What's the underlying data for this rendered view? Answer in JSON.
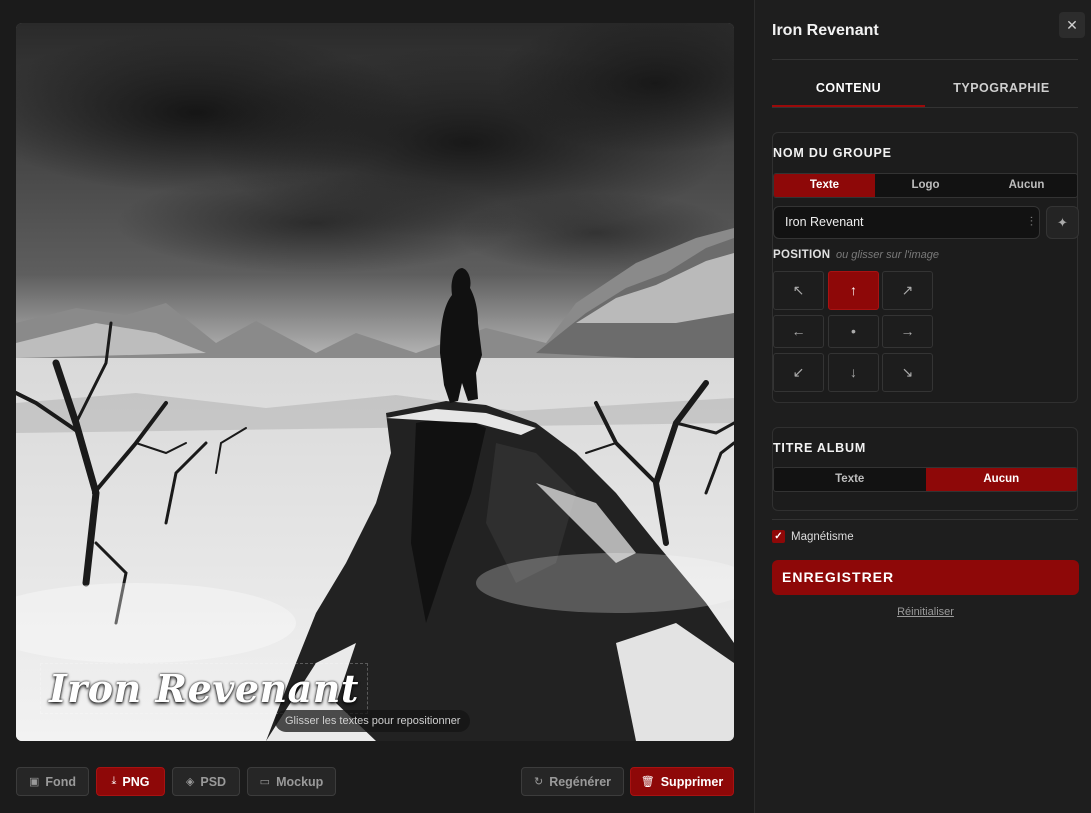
{
  "preview": {
    "band_title": "Iron Revenant",
    "drag_hint": "Glisser les textes pour repositionner"
  },
  "toolbar": {
    "fond": {
      "label": "Fond",
      "icon": "image-icon"
    },
    "png": {
      "label": "PNG",
      "icon": "download-icon"
    },
    "psd": {
      "label": "PSD",
      "icon": "layers-icon"
    },
    "mockup": {
      "label": "Mockup",
      "icon": "monitor-icon"
    },
    "regenerate": {
      "label": "Regénérer",
      "icon": "refresh-icon"
    },
    "delete": {
      "label": "Supprimer",
      "icon": "trash-icon"
    }
  },
  "panel": {
    "title": "Iron Revenant",
    "close_icon": "close-icon",
    "tabs": [
      {
        "label": "CONTENU",
        "active": true
      },
      {
        "label": "TYPOGRAPHIE",
        "active": false
      }
    ],
    "band_name": {
      "heading": "NOM DU GROUPE",
      "modes": [
        {
          "label": "Texte",
          "selected": true
        },
        {
          "label": "Logo",
          "selected": false
        },
        {
          "label": "Aucun",
          "selected": false
        }
      ],
      "value": "Iron Revenant",
      "position_label": "POSITION",
      "position_hint": "ou glisser sur l'image",
      "positions": [
        {
          "glyph": "↖",
          "name": "top-left",
          "selected": false
        },
        {
          "glyph": "↑",
          "name": "top",
          "selected": true
        },
        {
          "glyph": "↗",
          "name": "top-right",
          "selected": false
        },
        {
          "glyph": "←",
          "name": "left",
          "selected": false
        },
        {
          "glyph": "•",
          "name": "center",
          "selected": false
        },
        {
          "glyph": "→",
          "name": "right",
          "selected": false
        },
        {
          "glyph": "↙",
          "name": "bottom-left",
          "selected": false
        },
        {
          "glyph": "↓",
          "name": "bottom",
          "selected": false
        },
        {
          "glyph": "↘",
          "name": "bottom-right",
          "selected": false
        }
      ]
    },
    "album_title": {
      "heading": "TITRE ALBUM",
      "modes": [
        {
          "label": "Texte",
          "selected": false
        },
        {
          "label": "Aucun",
          "selected": true
        }
      ]
    },
    "magnetism": {
      "label": "Magnétisme",
      "checked": true
    },
    "save_label": "ENREGISTRER",
    "reset_label": "Réinitialiser"
  },
  "colors": {
    "accent": "#8e0808",
    "background": "#1b1b1b",
    "panel": "#1e1e1e"
  }
}
